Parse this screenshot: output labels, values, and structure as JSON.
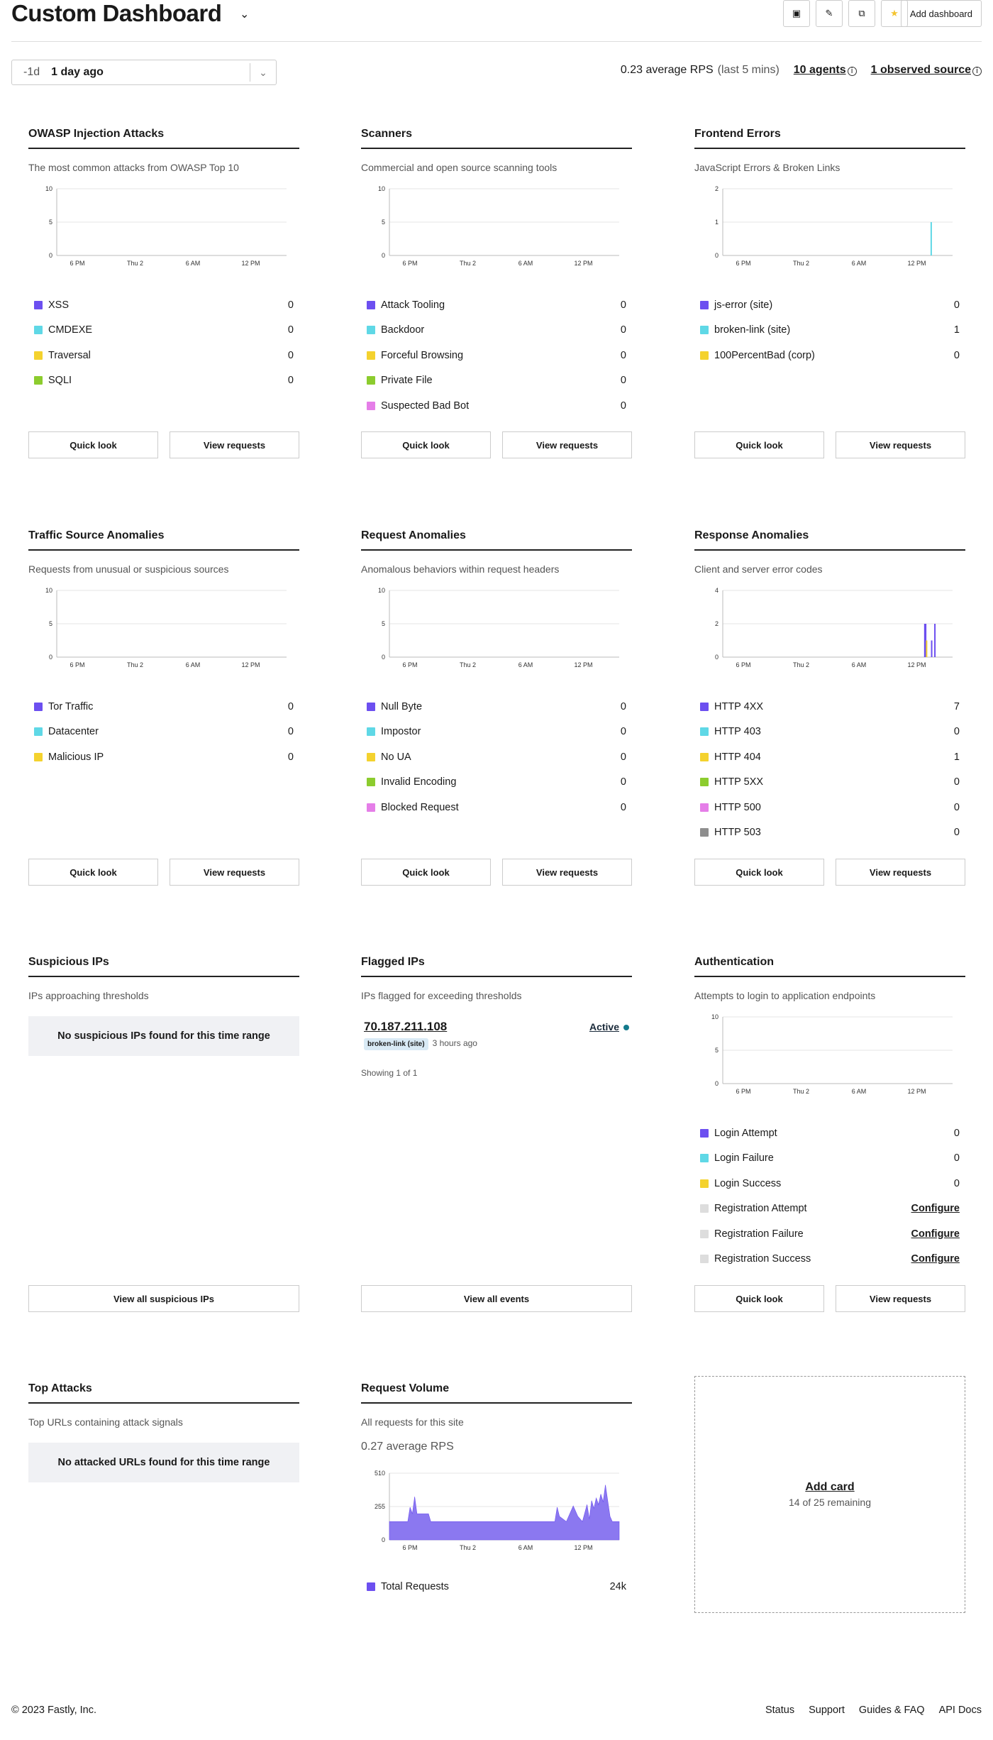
{
  "header": {
    "title": "Custom Dashboard",
    "add_dashboard": "Add dashboard"
  },
  "range": {
    "short": "-1d",
    "label": "1 day ago"
  },
  "stats": {
    "rps": "0.23 average RPS",
    "rps_window": "(last 5 mins)",
    "agents": "10 agents",
    "sources": "1 observed source"
  },
  "x_ticks": [
    "6 PM",
    "Thu 2",
    "6 AM",
    "12 PM"
  ],
  "buttons": {
    "quick": "Quick look",
    "view": "View requests"
  },
  "cards": [
    {
      "title": "OWASP Injection Attacks",
      "subtitle": "The most common attacks from OWASP Top 10",
      "chart_data": {
        "type": "bar",
        "x": [
          "6 PM",
          "Thu 2",
          "6 AM",
          "12 PM"
        ],
        "ylim": [
          0,
          10
        ],
        "yticks": [
          0,
          5,
          10
        ],
        "series": []
      },
      "legend": [
        {
          "label": "XSS",
          "value": "0",
          "color": "#6c4ff0"
        },
        {
          "label": "CMDEXE",
          "value": "0",
          "color": "#5fd8e6"
        },
        {
          "label": "Traversal",
          "value": "0",
          "color": "#f4d22e"
        },
        {
          "label": "SQLI",
          "value": "0",
          "color": "#8ccc2e"
        }
      ]
    },
    {
      "title": "Scanners",
      "subtitle": "Commercial and open source scanning tools",
      "chart_data": {
        "type": "bar",
        "x": [
          "6 PM",
          "Thu 2",
          "6 AM",
          "12 PM"
        ],
        "ylim": [
          0,
          10
        ],
        "yticks": [
          0,
          5,
          10
        ],
        "series": []
      },
      "legend": [
        {
          "label": "Attack Tooling",
          "value": "0",
          "color": "#6c4ff0"
        },
        {
          "label": "Backdoor",
          "value": "0",
          "color": "#5fd8e6"
        },
        {
          "label": "Forceful Browsing",
          "value": "0",
          "color": "#f4d22e"
        },
        {
          "label": "Private File",
          "value": "0",
          "color": "#8ccc2e"
        },
        {
          "label": "Suspected Bad Bot",
          "value": "0",
          "color": "#e57ee8"
        }
      ]
    },
    {
      "title": "Frontend Errors",
      "subtitle": "JavaScript Errors & Broken Links",
      "chart_data": {
        "type": "bar",
        "x": [
          "6 PM",
          "Thu 2",
          "6 AM",
          "12 PM"
        ],
        "ylim": [
          0,
          2
        ],
        "yticks": [
          0,
          1,
          2
        ],
        "series": [
          {
            "color": "#5fd8e6",
            "points": [
              [
                0.904,
                1
              ]
            ]
          }
        ]
      },
      "legend": [
        {
          "label": "js-error (site)",
          "value": "0",
          "color": "#6c4ff0"
        },
        {
          "label": "broken-link (site)",
          "value": "1",
          "color": "#5fd8e6"
        },
        {
          "label": "100PercentBad (corp)",
          "value": "0",
          "color": "#f4d22e"
        }
      ]
    },
    {
      "title": "Traffic Source Anomalies",
      "subtitle": "Requests from unusual or suspicious sources",
      "chart_data": {
        "type": "bar",
        "x": [
          "6 PM",
          "Thu 2",
          "6 AM",
          "12 PM"
        ],
        "ylim": [
          0,
          10
        ],
        "yticks": [
          0,
          5,
          10
        ],
        "series": []
      },
      "legend": [
        {
          "label": "Tor Traffic",
          "value": "0",
          "color": "#6c4ff0"
        },
        {
          "label": "Datacenter",
          "value": "0",
          "color": "#5fd8e6"
        },
        {
          "label": "Malicious IP",
          "value": "0",
          "color": "#f4d22e"
        }
      ]
    },
    {
      "title": "Request Anomalies",
      "subtitle": "Anomalous behaviors within request headers",
      "chart_data": {
        "type": "bar",
        "x": [
          "6 PM",
          "Thu 2",
          "6 AM",
          "12 PM"
        ],
        "ylim": [
          0,
          10
        ],
        "yticks": [
          0,
          5,
          10
        ],
        "series": []
      },
      "legend": [
        {
          "label": "Null Byte",
          "value": "0",
          "color": "#6c4ff0"
        },
        {
          "label": "Impostor",
          "value": "0",
          "color": "#5fd8e6"
        },
        {
          "label": "No UA",
          "value": "0",
          "color": "#f4d22e"
        },
        {
          "label": "Invalid Encoding",
          "value": "0",
          "color": "#8ccc2e"
        },
        {
          "label": "Blocked Request",
          "value": "0",
          "color": "#e57ee8"
        }
      ]
    },
    {
      "title": "Response Anomalies",
      "subtitle": "Client and server error codes",
      "chart_data": {
        "type": "bar",
        "x": [
          "6 PM",
          "Thu 2",
          "6 AM",
          "12 PM"
        ],
        "ylim": [
          0,
          4
        ],
        "yticks": [
          0,
          2,
          4
        ],
        "series": [
          {
            "color": "#6c4ff0",
            "points": [
              [
                0.876,
                2
              ],
              [
                0.88,
                2
              ],
              [
                0.906,
                1
              ],
              [
                0.92,
                2
              ]
            ]
          },
          {
            "color": "#f4d22e",
            "points": [
              [
                0.884,
                1
              ]
            ]
          }
        ]
      },
      "legend": [
        {
          "label": "HTTP 4XX",
          "value": "7",
          "color": "#6c4ff0"
        },
        {
          "label": "HTTP 403",
          "value": "0",
          "color": "#5fd8e6"
        },
        {
          "label": "HTTP 404",
          "value": "1",
          "color": "#f4d22e"
        },
        {
          "label": "HTTP 5XX",
          "value": "0",
          "color": "#8ccc2e"
        },
        {
          "label": "HTTP 500",
          "value": "0",
          "color": "#e57ee8"
        },
        {
          "label": "HTTP 503",
          "value": "0",
          "color": "#8e8e8e"
        }
      ]
    }
  ],
  "suspicious": {
    "title": "Suspicious IPs",
    "subtitle": "IPs approaching thresholds",
    "empty": "No suspicious IPs found for this time range",
    "button": "View all suspicious IPs"
  },
  "flagged": {
    "title": "Flagged IPs",
    "subtitle": "IPs flagged for exceeding thresholds",
    "ip": "70.187.211.108",
    "status": "Active",
    "tag": "broken-link (site)",
    "ago": "3 hours ago",
    "showing": "Showing 1 of 1",
    "button": "View all events"
  },
  "auth": {
    "title": "Authentication",
    "subtitle": "Attempts to login to application endpoints",
    "chart_data": {
      "type": "bar",
      "x": [
        "6 PM",
        "Thu 2",
        "6 AM",
        "12 PM"
      ],
      "ylim": [
        0,
        10
      ],
      "yticks": [
        0,
        5,
        10
      ],
      "series": []
    },
    "legend": [
      {
        "label": "Login Attempt",
        "value": "0",
        "color": "#6c4ff0"
      },
      {
        "label": "Login Failure",
        "value": "0",
        "color": "#5fd8e6"
      },
      {
        "label": "Login Success",
        "value": "0",
        "color": "#f4d22e"
      },
      {
        "label": "Registration Attempt",
        "value": "Configure",
        "color": "#dddddd",
        "configure": true
      },
      {
        "label": "Registration Failure",
        "value": "Configure",
        "color": "#dddddd",
        "configure": true
      },
      {
        "label": "Registration Success",
        "value": "Configure",
        "color": "#dddddd",
        "configure": true
      }
    ]
  },
  "top_attacks": {
    "title": "Top Attacks",
    "subtitle": "Top URLs containing attack signals",
    "empty": "No attacked URLs found for this time range"
  },
  "volume": {
    "title": "Request Volume",
    "subtitle": "All requests for this site",
    "avg": "0.27 average RPS",
    "chart_data": {
      "type": "area",
      "x": [
        "6 PM",
        "Thu 2",
        "6 AM",
        "12 PM"
      ],
      "ylim": [
        0,
        510
      ],
      "yticks": [
        0,
        255,
        510
      ],
      "color": "#8b78f0",
      "points": [
        [
          0,
          140
        ],
        [
          0.08,
          140
        ],
        [
          0.09,
          250
        ],
        [
          0.1,
          200
        ],
        [
          0.11,
          330
        ],
        [
          0.12,
          200
        ],
        [
          0.17,
          200
        ],
        [
          0.18,
          140
        ],
        [
          0.72,
          140
        ],
        [
          0.73,
          250
        ],
        [
          0.74,
          180
        ],
        [
          0.77,
          140
        ],
        [
          0.8,
          260
        ],
        [
          0.82,
          180
        ],
        [
          0.84,
          140
        ],
        [
          0.86,
          270
        ],
        [
          0.87,
          160
        ],
        [
          0.88,
          300
        ],
        [
          0.89,
          240
        ],
        [
          0.9,
          320
        ],
        [
          0.91,
          270
        ],
        [
          0.92,
          350
        ],
        [
          0.93,
          290
        ],
        [
          0.94,
          420
        ],
        [
          0.95,
          300
        ],
        [
          0.96,
          180
        ],
        [
          0.97,
          140
        ],
        [
          1,
          140
        ]
      ]
    },
    "legend": [
      {
        "label": "Total Requests",
        "value": "24k",
        "color": "#6c4ff0"
      }
    ]
  },
  "add_card": {
    "link": "Add card",
    "remaining": "14 of 25 remaining"
  },
  "footer": {
    "copyright": "© 2023 Fastly, Inc.",
    "links": [
      "Status",
      "Support",
      "Guides & FAQ",
      "API Docs"
    ]
  }
}
